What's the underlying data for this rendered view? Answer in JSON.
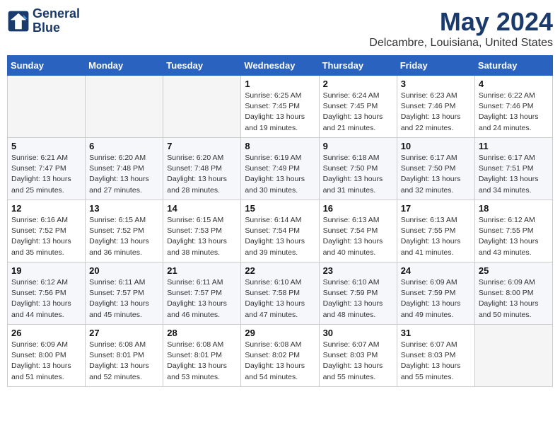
{
  "logo": {
    "line1": "General",
    "line2": "Blue"
  },
  "title": "May 2024",
  "location": "Delcambre, Louisiana, United States",
  "days_of_week": [
    "Sunday",
    "Monday",
    "Tuesday",
    "Wednesday",
    "Thursday",
    "Friday",
    "Saturday"
  ],
  "weeks": [
    [
      {
        "day": "",
        "info": ""
      },
      {
        "day": "",
        "info": ""
      },
      {
        "day": "",
        "info": ""
      },
      {
        "day": "1",
        "info": "Sunrise: 6:25 AM\nSunset: 7:45 PM\nDaylight: 13 hours\nand 19 minutes."
      },
      {
        "day": "2",
        "info": "Sunrise: 6:24 AM\nSunset: 7:45 PM\nDaylight: 13 hours\nand 21 minutes."
      },
      {
        "day": "3",
        "info": "Sunrise: 6:23 AM\nSunset: 7:46 PM\nDaylight: 13 hours\nand 22 minutes."
      },
      {
        "day": "4",
        "info": "Sunrise: 6:22 AM\nSunset: 7:46 PM\nDaylight: 13 hours\nand 24 minutes."
      }
    ],
    [
      {
        "day": "5",
        "info": "Sunrise: 6:21 AM\nSunset: 7:47 PM\nDaylight: 13 hours\nand 25 minutes."
      },
      {
        "day": "6",
        "info": "Sunrise: 6:20 AM\nSunset: 7:48 PM\nDaylight: 13 hours\nand 27 minutes."
      },
      {
        "day": "7",
        "info": "Sunrise: 6:20 AM\nSunset: 7:48 PM\nDaylight: 13 hours\nand 28 minutes."
      },
      {
        "day": "8",
        "info": "Sunrise: 6:19 AM\nSunset: 7:49 PM\nDaylight: 13 hours\nand 30 minutes."
      },
      {
        "day": "9",
        "info": "Sunrise: 6:18 AM\nSunset: 7:50 PM\nDaylight: 13 hours\nand 31 minutes."
      },
      {
        "day": "10",
        "info": "Sunrise: 6:17 AM\nSunset: 7:50 PM\nDaylight: 13 hours\nand 32 minutes."
      },
      {
        "day": "11",
        "info": "Sunrise: 6:17 AM\nSunset: 7:51 PM\nDaylight: 13 hours\nand 34 minutes."
      }
    ],
    [
      {
        "day": "12",
        "info": "Sunrise: 6:16 AM\nSunset: 7:52 PM\nDaylight: 13 hours\nand 35 minutes."
      },
      {
        "day": "13",
        "info": "Sunrise: 6:15 AM\nSunset: 7:52 PM\nDaylight: 13 hours\nand 36 minutes."
      },
      {
        "day": "14",
        "info": "Sunrise: 6:15 AM\nSunset: 7:53 PM\nDaylight: 13 hours\nand 38 minutes."
      },
      {
        "day": "15",
        "info": "Sunrise: 6:14 AM\nSunset: 7:54 PM\nDaylight: 13 hours\nand 39 minutes."
      },
      {
        "day": "16",
        "info": "Sunrise: 6:13 AM\nSunset: 7:54 PM\nDaylight: 13 hours\nand 40 minutes."
      },
      {
        "day": "17",
        "info": "Sunrise: 6:13 AM\nSunset: 7:55 PM\nDaylight: 13 hours\nand 41 minutes."
      },
      {
        "day": "18",
        "info": "Sunrise: 6:12 AM\nSunset: 7:55 PM\nDaylight: 13 hours\nand 43 minutes."
      }
    ],
    [
      {
        "day": "19",
        "info": "Sunrise: 6:12 AM\nSunset: 7:56 PM\nDaylight: 13 hours\nand 44 minutes."
      },
      {
        "day": "20",
        "info": "Sunrise: 6:11 AM\nSunset: 7:57 PM\nDaylight: 13 hours\nand 45 minutes."
      },
      {
        "day": "21",
        "info": "Sunrise: 6:11 AM\nSunset: 7:57 PM\nDaylight: 13 hours\nand 46 minutes."
      },
      {
        "day": "22",
        "info": "Sunrise: 6:10 AM\nSunset: 7:58 PM\nDaylight: 13 hours\nand 47 minutes."
      },
      {
        "day": "23",
        "info": "Sunrise: 6:10 AM\nSunset: 7:59 PM\nDaylight: 13 hours\nand 48 minutes."
      },
      {
        "day": "24",
        "info": "Sunrise: 6:09 AM\nSunset: 7:59 PM\nDaylight: 13 hours\nand 49 minutes."
      },
      {
        "day": "25",
        "info": "Sunrise: 6:09 AM\nSunset: 8:00 PM\nDaylight: 13 hours\nand 50 minutes."
      }
    ],
    [
      {
        "day": "26",
        "info": "Sunrise: 6:09 AM\nSunset: 8:00 PM\nDaylight: 13 hours\nand 51 minutes."
      },
      {
        "day": "27",
        "info": "Sunrise: 6:08 AM\nSunset: 8:01 PM\nDaylight: 13 hours\nand 52 minutes."
      },
      {
        "day": "28",
        "info": "Sunrise: 6:08 AM\nSunset: 8:01 PM\nDaylight: 13 hours\nand 53 minutes."
      },
      {
        "day": "29",
        "info": "Sunrise: 6:08 AM\nSunset: 8:02 PM\nDaylight: 13 hours\nand 54 minutes."
      },
      {
        "day": "30",
        "info": "Sunrise: 6:07 AM\nSunset: 8:03 PM\nDaylight: 13 hours\nand 55 minutes."
      },
      {
        "day": "31",
        "info": "Sunrise: 6:07 AM\nSunset: 8:03 PM\nDaylight: 13 hours\nand 55 minutes."
      },
      {
        "day": "",
        "info": ""
      }
    ]
  ]
}
